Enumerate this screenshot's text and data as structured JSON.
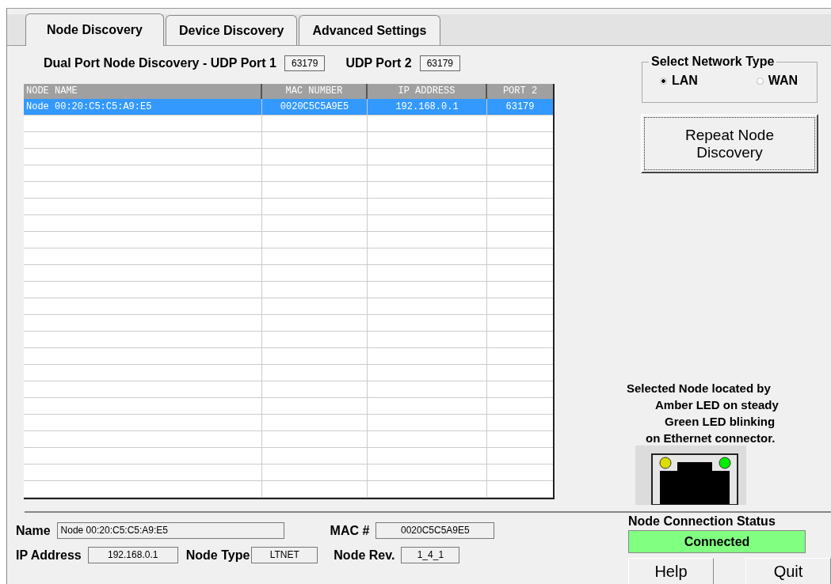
{
  "tabs": [
    {
      "label": "Node Discovery",
      "selected": true
    },
    {
      "label": "Device Discovery",
      "selected": false
    },
    {
      "label": "Advanced Settings",
      "selected": false
    }
  ],
  "ports": {
    "title": "Dual Port Node Discovery - UDP Port 1",
    "port1": "63179",
    "port2_label": "UDP Port 2",
    "port2": "63179"
  },
  "table": {
    "columns": [
      "NODE NAME",
      "MAC NUMBER",
      "IP ADDRESS",
      "PORT 2"
    ],
    "rows": [
      {
        "cells": [
          "Node 00:20:C5:C5:A9:E5",
          "0020C5C5A9E5",
          "192.168.0.1",
          "63179"
        ],
        "selected": true
      }
    ]
  },
  "network_type": {
    "title": "Select Network Type",
    "options": [
      {
        "label": "LAN",
        "selected": true
      },
      {
        "label": "WAN",
        "selected": false
      }
    ]
  },
  "repeat_button": "Repeat Node Discovery",
  "info_lines": [
    "Selected Node located by",
    "Amber LED on steady",
    "Green LED blinking",
    "on Ethernet connector."
  ],
  "details": {
    "name_label": "Name",
    "name": "Node 00:20:C5:C5:A9:E5",
    "mac_label": "MAC #",
    "mac": "0020C5C5A9E5",
    "ip_label": "IP Address",
    "ip": "192.168.0.1",
    "type_label": "Node Type",
    "type": "LTNET",
    "rev_label": "Node Rev.",
    "rev": "1_4_1"
  },
  "status": {
    "title": "Node Connection Status",
    "value": "Connected"
  },
  "buttons": [
    "Help",
    "Quit"
  ]
}
